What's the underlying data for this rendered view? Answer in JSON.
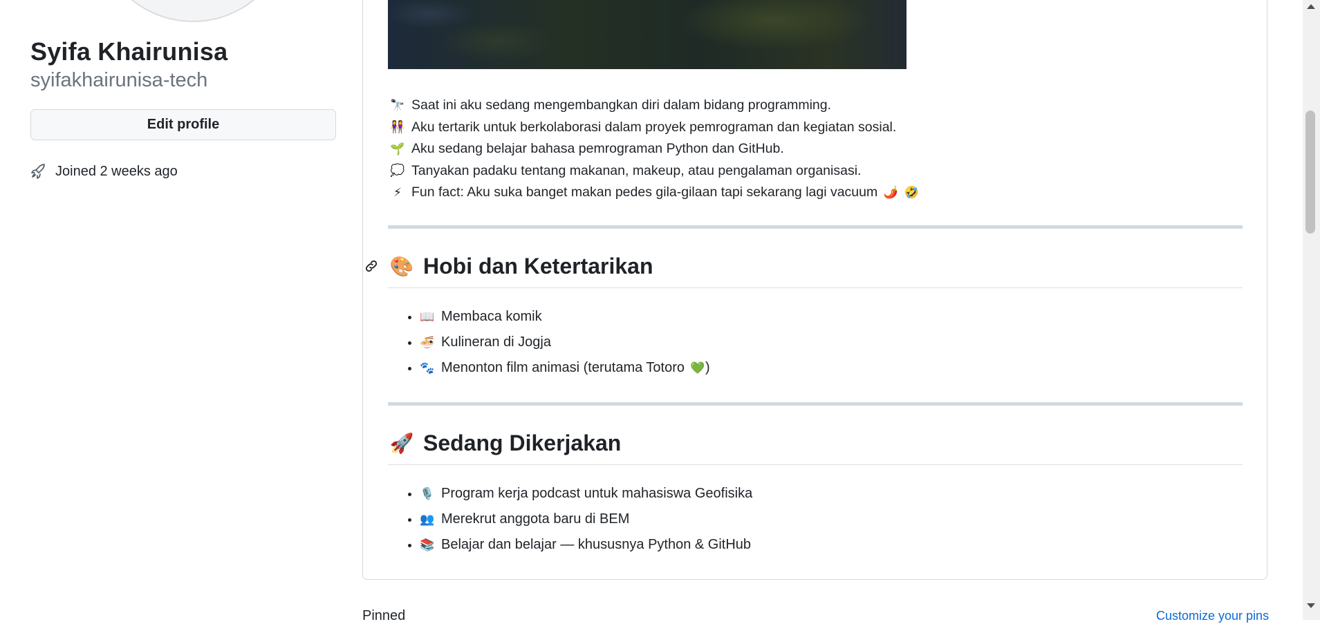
{
  "profile": {
    "name": "Syifa Khairunisa",
    "login": "syifakhairunisa-tech",
    "edit_button": "Edit profile",
    "joined": "Joined 2 weeks ago"
  },
  "readme": {
    "intro": [
      {
        "icon": "telescope-icon",
        "glyph": "🔭",
        "text": "Saat ini aku sedang mengembangkan diri dalam bidang programming."
      },
      {
        "icon": "people-icon",
        "glyph": "👭",
        "text": "Aku tertarik untuk berkolaborasi dalam proyek pemrograman dan kegiatan sosial."
      },
      {
        "icon": "seedling-icon",
        "glyph": "🌱",
        "text": "Aku sedang belajar bahasa pemrograman Python dan GitHub."
      },
      {
        "icon": "speech-bubble-icon",
        "glyph": "💭",
        "text": "Tanyakan padaku tentang makanan, makeup, atau pengalaman organisasi."
      },
      {
        "icon": "lightning-icon",
        "glyph": "⚡",
        "text": "Fun fact: Aku suka banget makan pedes gila-gilaan tapi sekarang lagi vacuum",
        "trailing": [
          "🌶️",
          "🤣"
        ]
      }
    ],
    "sections": [
      {
        "emoji": "🎨",
        "title": "Hobi dan Ketertarikan",
        "items": [
          {
            "glyph": "📖",
            "text": "Membaca komik"
          },
          {
            "glyph": "🍜",
            "text": "Kulineran di Jogja"
          },
          {
            "glyph": "🐾",
            "text": "Menonton film animasi (terutama Totoro",
            "trailing": "💚",
            "after": ")"
          }
        ]
      },
      {
        "emoji": "🚀",
        "title": "Sedang Dikerjakan",
        "items": [
          {
            "glyph": "🎙️",
            "text": "Program kerja podcast untuk mahasiswa Geofisika"
          },
          {
            "glyph": "👥",
            "text": "Merekrut anggota baru di BEM"
          },
          {
            "glyph": "📚",
            "text": "Belajar dan belajar — khususnya Python & GitHub"
          }
        ]
      }
    ]
  },
  "footer": {
    "pinned": "Pinned",
    "customize": "Customize your pins"
  }
}
